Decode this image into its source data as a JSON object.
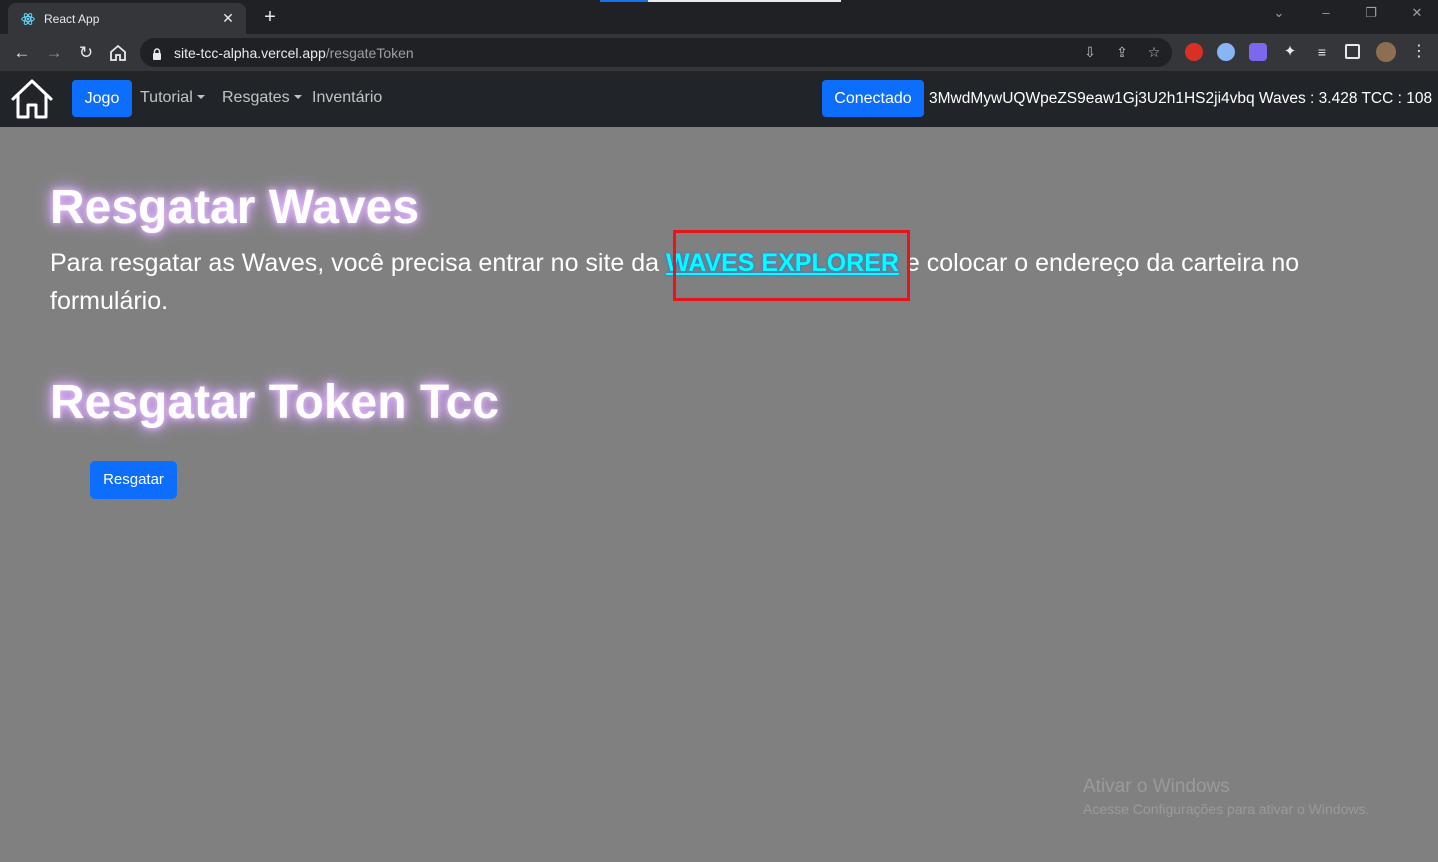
{
  "browser": {
    "tab_title": "React App",
    "url_host": "site-tcc-alpha.vercel.app",
    "url_path": "/resgateToken"
  },
  "navbar": {
    "jogo_label": "Jogo",
    "tutorial_label": "Tutorial",
    "resgates_label": "Resgates",
    "inventario_label": "Inventário",
    "conectado_label": "Conectado",
    "wallet_info": "3MwdMywUQWpeZS9eaw1Gj3U2h1HS2ji4vbq Waves : 3.428 TCC : 108"
  },
  "main": {
    "heading_waves": "Resgatar Waves",
    "paragraph_before": "Para resgatar as Waves, você precisa entrar no site da ",
    "explorer_link": "WAVES EXPLORER",
    "paragraph_after": " e colocar o endereço da carteira no formulário.",
    "heading_token": "Resgatar Token Tcc",
    "resgatar_button": "Resgatar"
  },
  "watermark": {
    "title": "Ativar o Windows",
    "subtitle": "Acesse Configurações para ativar o Windows."
  },
  "colors": {
    "primary": "#0d6efd",
    "navbar_bg": "#212529",
    "page_bg": "#808080",
    "link": "#00ffff",
    "highlight": "#e8141c"
  }
}
